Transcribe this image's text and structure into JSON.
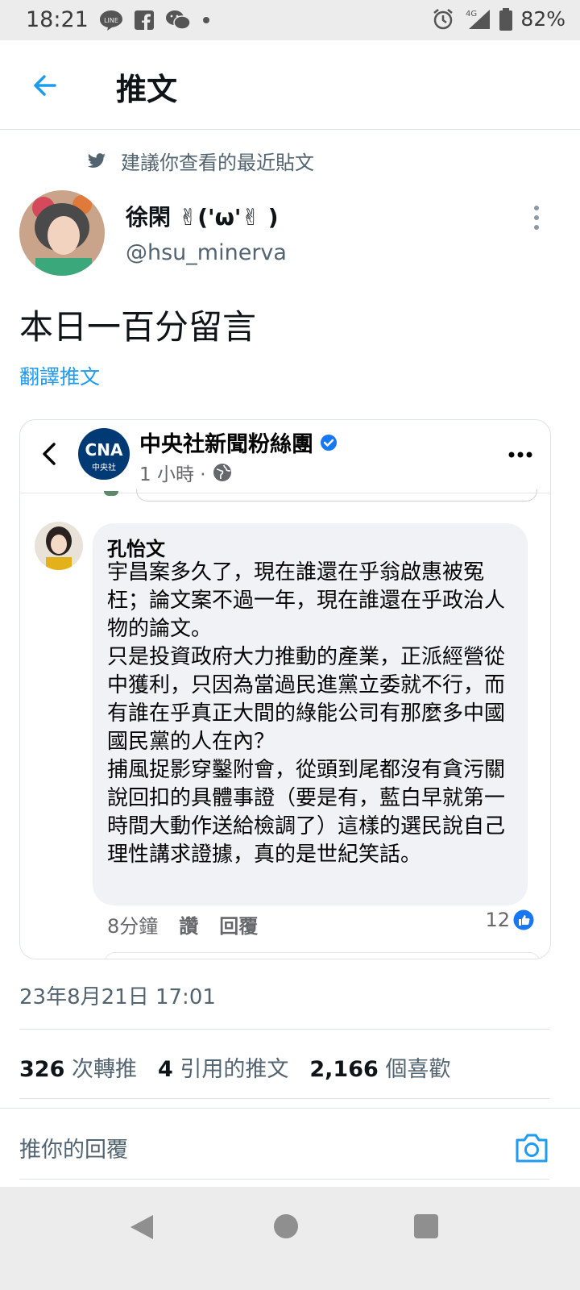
{
  "status_bar": {
    "time": "18:21",
    "network": "4G",
    "battery": "82%",
    "icons": [
      "line-icon",
      "facebook-icon",
      "wechat-icon",
      "dot-icon",
      "alarm-icon",
      "signal-icon",
      "battery-icon"
    ]
  },
  "header": {
    "title": "推文"
  },
  "suggestion": {
    "text": "建議你查看的最近貼文"
  },
  "author": {
    "name": "徐閑 ✌('ω'✌ )",
    "handle": "@hsu_minerva"
  },
  "tweet": {
    "text": "本日一百分留言",
    "translate_label": "翻譯推文"
  },
  "embed": {
    "page_name": "中央社新聞粉絲團",
    "logo_text": "中央社",
    "time_ago": "1 小時 ·",
    "comment": {
      "author": "孔怡文",
      "text": "宇昌案多久了，現在誰還在乎翁啟惠被冤枉；論文案不過一年，現在誰還在乎政治人物的論文。\n只是投資政府大力推動的產業，正派經營從中獲利，只因為當過民進黨立委就不行，而有誰在乎真正大間的綠能公司有那麼多中國國民黨的人在內？\n捕風捉影穿鑿附會，從頭到尾都沒有貪污關說回扣的具體事證（要是有，藍白早就第一時間大動作送給檢調了）這樣的選民說自己理性講求證據，真的是世紀笑話。",
      "time": "8分鐘",
      "like_action": "讚",
      "reply_action": "回覆",
      "like_count": "12"
    }
  },
  "timestamp": "23年8月21日 17:01",
  "stats": {
    "retweets": "326",
    "retweets_label": "次轉推",
    "quotes": "4",
    "quotes_label": "引用的推文",
    "likes": "2,166",
    "likes_label": "個喜歡"
  },
  "reply": {
    "placeholder": "推你的回覆"
  },
  "colors": {
    "accent": "#1d9bf0",
    "fb_blue": "#1877f2",
    "cna_navy": "#003a75"
  }
}
